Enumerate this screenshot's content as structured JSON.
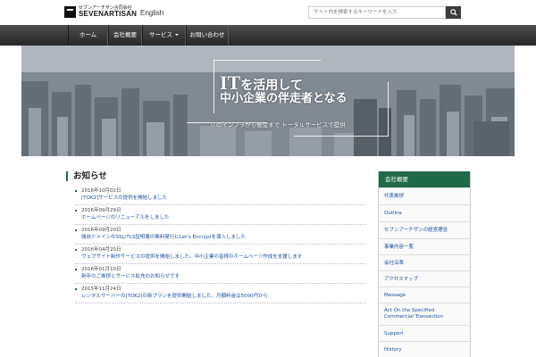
{
  "header": {
    "logo_jp": "セブンアーチザン合同会社",
    "logo_en": "SEVENARTISAN",
    "english_link": "English",
    "search_placeholder": "サイト内を検索するキーワードを入力"
  },
  "nav": {
    "items": [
      {
        "label": "ホーム"
      },
      {
        "label": "会社概要"
      },
      {
        "label": "サービス"
      },
      {
        "label": "お問い合わせ"
      }
    ]
  },
  "hero": {
    "title_big": "IT",
    "title_line1_rest": "を活用して",
    "title_line2": "中小企業の伴走者となる",
    "subtitle": "ITのインフラから販促まで トータルサービスで提供"
  },
  "news": {
    "heading": "お知らせ",
    "items": [
      {
        "date": "2016年10月02日",
        "title": "[TOK2]サービスの提供を開始しました"
      },
      {
        "date": "2016年09月29日",
        "title": "ホームページのリニューアルをしました"
      },
      {
        "date": "2016年09月20日",
        "title": "独自ドメインのSSL/TLS証明書の無料発行にLet's Encryptを導入しました"
      },
      {
        "date": "2016年04月20日",
        "title": "ウェブサイト制作サービスの提供を開始しました。中小企業の皆様のホームページ作成を支援します"
      },
      {
        "date": "2016年01月10日",
        "title": "新年のご挨拶とサービス拡充のお知らせです"
      },
      {
        "date": "2015年11月24日",
        "title": "レンタルサーバーの[TOK2]の新プランを提供開始しました。月額料金は5000円から"
      }
    ]
  },
  "sidebar": {
    "header": "会社概要",
    "items": [
      {
        "label": "代表挨拶"
      },
      {
        "label": "Outline"
      },
      {
        "label": "セブンアーチザンの経営理念"
      },
      {
        "label": "事業内容一覧"
      },
      {
        "label": "会社沿革"
      },
      {
        "label": "アクセスマップ"
      },
      {
        "label": "Message"
      },
      {
        "label": "Act On the Specified Commercial Transaction"
      },
      {
        "label": "Support"
      },
      {
        "label": "History"
      }
    ]
  },
  "colors": {
    "brand_green": "#1f6a48",
    "nav_dark": "#2e2e2e",
    "link_blue": "#1a4c9a"
  }
}
